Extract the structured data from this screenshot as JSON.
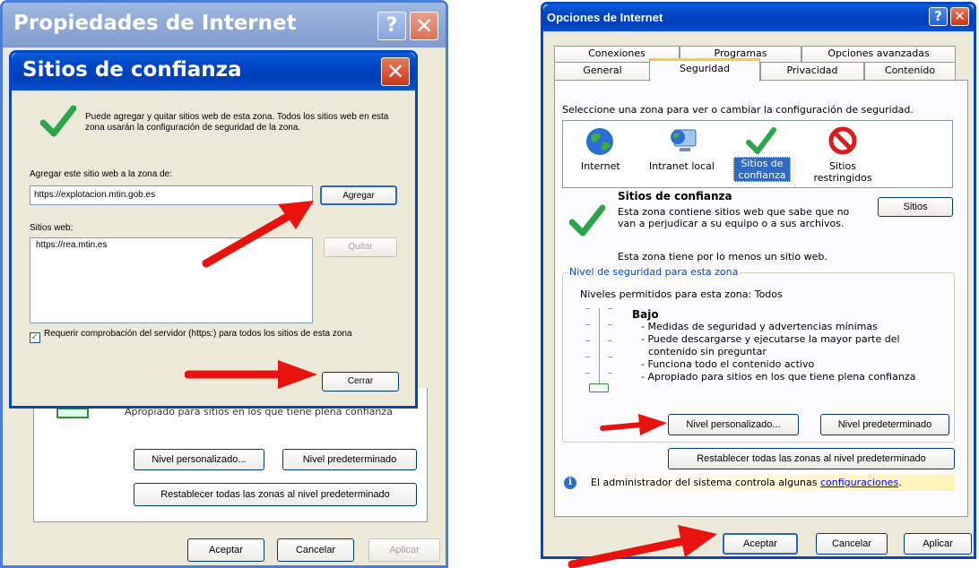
{
  "left_window": {
    "title": "Propiedades de Internet",
    "buttons": {
      "nivel_personalizado": "Nivel personalizado...",
      "nivel_predeterminado": "Nivel predeterminado",
      "restablecer": "Restablecer todas las zonas al nivel predeterminado",
      "aceptar": "Aceptar",
      "cancelar": "Cancelar",
      "aplicar": "Aplicar"
    },
    "partial_text": "Apropiado para sitios en los que tiene plena confianza"
  },
  "dialog": {
    "title": "Sitios de confianza",
    "info_text": "Puede agregar y quitar sitios web de esta zona. Todos los sitios web en esta zona usarán la configuración de seguridad de la zona.",
    "add_label": "Agregar este sitio web a la zona de:",
    "add_value": "https://explotacion.mtin.gob.es",
    "add_button": "Agregar",
    "sites_label": "Sitios web:",
    "sites": [
      "https://rea.mtin.es"
    ],
    "remove_button": "Quitar",
    "require_https_label": "Requerir comprobación del servidor (https:) para todos los sitios de esta zona",
    "require_https_checked": true,
    "close_button": "Cerrar"
  },
  "right_window": {
    "title": "Opciones de Internet",
    "tabs_back": [
      "Conexiones",
      "Programas",
      "Opciones avanzadas"
    ],
    "tabs_front": [
      "General",
      "Seguridad",
      "Privacidad",
      "Contenido"
    ],
    "active_tab": "Seguridad",
    "zone_prompt": "Seleccione una zona para ver o cambiar la configuración de seguridad.",
    "zones": [
      {
        "label": "Internet",
        "icon": "globe-icon"
      },
      {
        "label": "Intranet local",
        "icon": "intranet-icon"
      },
      {
        "label": "Sitios de confianza",
        "icon": "checkmark-icon",
        "selected": true
      },
      {
        "label": "Sitios restringidos",
        "icon": "restricted-icon"
      }
    ],
    "zone_title": "Sitios de confianza",
    "zone_desc": "Esta zona contiene sitios web que sabe que no van a perjudicar a su equipo o a sus archivos.",
    "zone_note": "Esta zona tiene por lo menos un sitio web.",
    "sites_button": "Sitios",
    "security_level_legend": "Nivel de seguridad para esta zona",
    "allowed_levels": "Niveles permitidos para esta zona: Todos",
    "level_name": "Bajo",
    "level_bullets": [
      "- Medidas de seguridad y advertencias mínimas",
      "- Puede descargarse y ejecutarse la mayor parte del",
      "contenido sin preguntar",
      "- Funciona todo el contenido activo",
      "- Apropiado para sitios en los que tiene plena confianza"
    ],
    "custom_level_button": "Nivel personalizado...",
    "default_level_button": "Nivel predeterminado",
    "reset_all_button": "Restablecer todas las zonas al nivel predeterminado",
    "admin_note_prefix": "El administrador del sistema controla algunas",
    "admin_note_link": "configuraciones",
    "admin_note_suffix": ".",
    "ok_button": "Aceptar",
    "cancel_button": "Cancelar",
    "apply_button": "Aplicar"
  },
  "colors": {
    "xp_blue": "#0047c7",
    "selection": "#316ac5",
    "arrow_red": "#e8130f",
    "link": "#0000ff"
  }
}
